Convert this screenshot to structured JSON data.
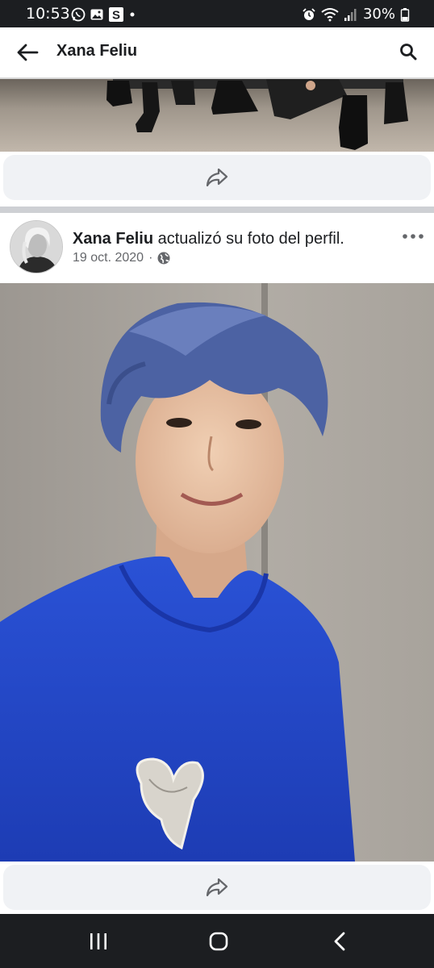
{
  "status_bar": {
    "time": "10:53",
    "battery": "30%",
    "left_icons": [
      "whatsapp-icon",
      "gallery-icon",
      "s-app-icon",
      "dot-icon"
    ],
    "right_icons": [
      "alarm-icon",
      "wifi-icon",
      "signal-icon",
      "battery-icon"
    ]
  },
  "header": {
    "title": "Xana Feliu",
    "back_icon": "arrow-left-icon",
    "search_icon": "search-icon"
  },
  "post": {
    "author": "Xana Feliu",
    "action": " actualizó su foto del perfil.",
    "date": "19 oct. 2020",
    "separator": "·",
    "privacy_icon": "globe-icon",
    "more_icon": "more-horizontal-icon"
  },
  "share": {
    "icon": "share-icon"
  },
  "nav": {
    "recents_icon": "recents-icon",
    "home_icon": "home-icon",
    "back_icon": "back-chevron-icon"
  },
  "colors": {
    "status_bar_bg": "#1c1e21",
    "share_bar_bg": "#f0f2f5",
    "divider": "#ced0d4",
    "meta_text": "#65676b",
    "hoodie_blue": "#2448c8",
    "hair_blue": "#4a5f9e"
  }
}
